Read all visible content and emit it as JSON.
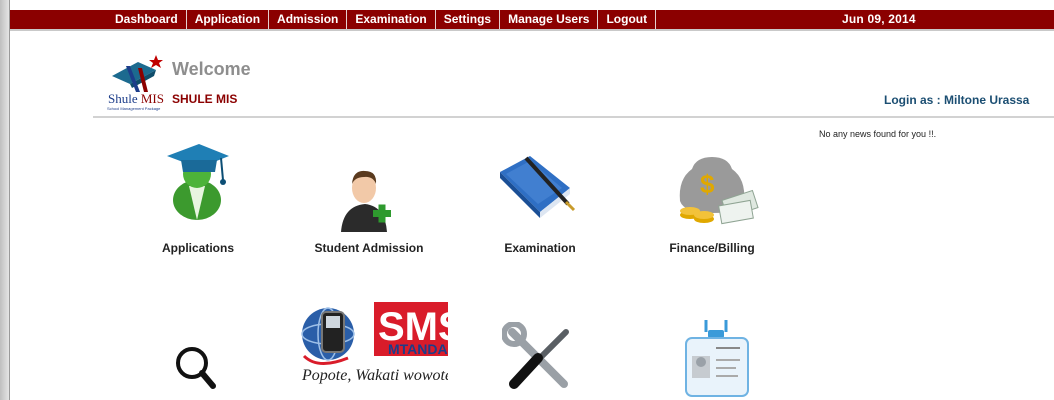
{
  "nav": {
    "items": [
      "Dashboard",
      "Application",
      "Admission",
      "Examination",
      "Settings",
      "Manage Users",
      "Logout"
    ],
    "date": "Jun 09, 2014"
  },
  "header": {
    "welcome": "Welcome",
    "app_name": "SHULE MIS",
    "logo_text_a": "Shule ",
    "logo_text_b": "MIS",
    "logo_sub": "School Management Package",
    "login_as": "Login as : Miltone Urassa"
  },
  "news": {
    "message": "No any news found for you !!."
  },
  "tiles": {
    "row1": [
      {
        "label": "Applications",
        "icon": "graduate-icon"
      },
      {
        "label": "Student Admission",
        "icon": "add-student-icon"
      },
      {
        "label": "Examination",
        "icon": "book-pen-icon"
      },
      {
        "label": "Finance/Billing",
        "icon": "money-bag-icon"
      }
    ],
    "row2": [
      {
        "icon": "search-icon"
      },
      {
        "icon": "sms-mtandao-icon",
        "sms_text": "SMS",
        "sms_sub": "MTANDAO",
        "slogan": "Popote, Wakati wowote"
      },
      {
        "icon": "tools-icon"
      },
      {
        "icon": "id-card-icon"
      }
    ]
  },
  "colors": {
    "topbar": "#8b0000",
    "login": "#1b4e72",
    "welcome": "#8e8e8e"
  }
}
